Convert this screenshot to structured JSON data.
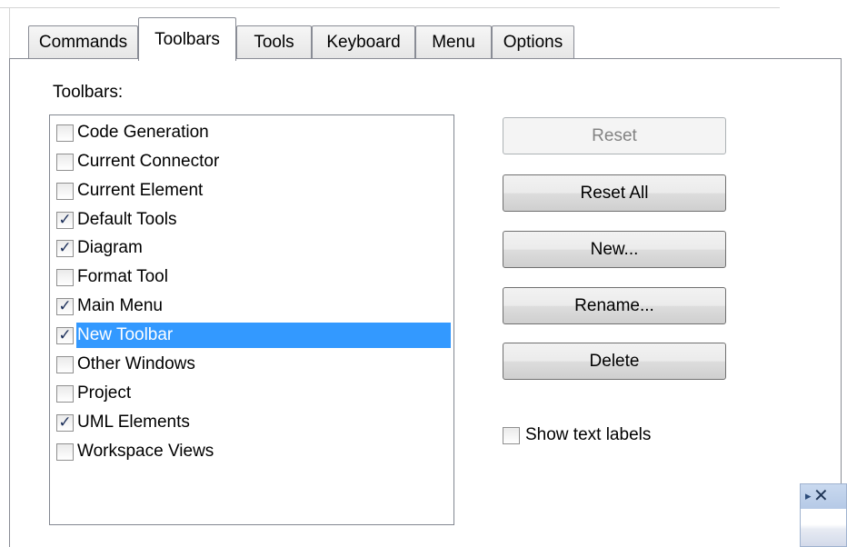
{
  "tabs": [
    {
      "label": "Commands",
      "active": false
    },
    {
      "label": "Toolbars",
      "active": true
    },
    {
      "label": "Tools",
      "active": false
    },
    {
      "label": "Keyboard",
      "active": false
    },
    {
      "label": "Menu",
      "active": false
    },
    {
      "label": "Options",
      "active": false
    }
  ],
  "toolbars_section": {
    "label": "Toolbars:",
    "items": [
      {
        "label": "Code Generation",
        "checked": false,
        "selected": false
      },
      {
        "label": "Current Connector",
        "checked": false,
        "selected": false
      },
      {
        "label": "Current Element",
        "checked": false,
        "selected": false
      },
      {
        "label": "Default Tools",
        "checked": true,
        "selected": false
      },
      {
        "label": "Diagram",
        "checked": true,
        "selected": false
      },
      {
        "label": "Format Tool",
        "checked": false,
        "selected": false
      },
      {
        "label": "Main Menu",
        "checked": true,
        "selected": false
      },
      {
        "label": "New Toolbar",
        "checked": true,
        "selected": true
      },
      {
        "label": "Other Windows",
        "checked": false,
        "selected": false
      },
      {
        "label": "Project",
        "checked": false,
        "selected": false
      },
      {
        "label": "UML Elements",
        "checked": true,
        "selected": false
      },
      {
        "label": "Workspace Views",
        "checked": false,
        "selected": false
      }
    ]
  },
  "buttons": {
    "reset": {
      "label": "Reset",
      "enabled": false
    },
    "reset_all": {
      "label": "Reset All",
      "enabled": true
    },
    "new": {
      "label": "New...",
      "enabled": true
    },
    "rename": {
      "label": "Rename...",
      "enabled": true
    },
    "delete": {
      "label": "Delete",
      "enabled": true
    }
  },
  "show_text_labels": {
    "label": "Show text labels",
    "checked": false
  },
  "floating_toolbar": {
    "grip_icon": "toolbar-grip-icon",
    "close_icon": "close-icon",
    "close_glyph": "✕",
    "grip_glyph": "▸"
  },
  "colors": {
    "selection": "#3399ff",
    "selection_text": "#ffffff",
    "disabled_text": "#838383"
  }
}
